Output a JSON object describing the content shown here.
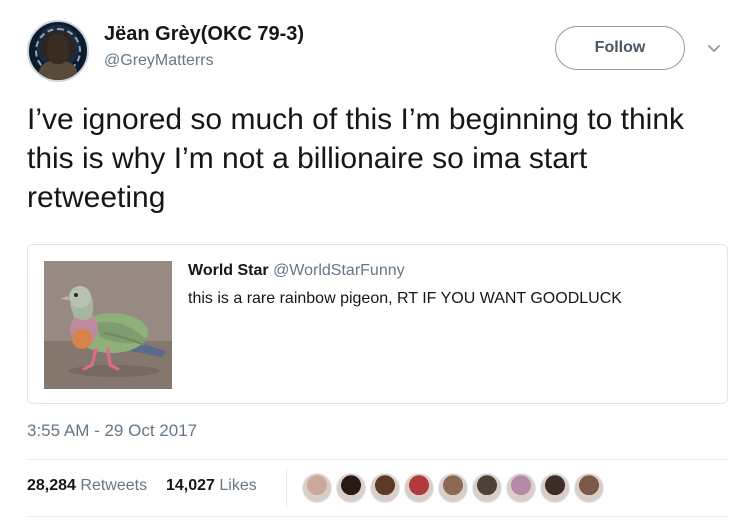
{
  "author": {
    "name": "Jëan Grèy(OKC 79-3)",
    "handle": "@GreyMatterrs",
    "avatar_icon": "avatar-image"
  },
  "actions": {
    "follow_label": "Follow",
    "menu_icon": "chevron-down-icon"
  },
  "tweet": {
    "text": "I’ve ignored so much of this I’m beginning to think this is why I’m not a billionaire so ima start retweeting",
    "timestamp": "3:55 AM - 29 Oct 2017"
  },
  "quoted_tweet": {
    "name": "World Star",
    "handle": "@WorldStarFunny",
    "text": "this is a rare rainbow pigeon, RT IF YOU WANT GOODLUCK",
    "image_icon": "rainbow-pigeon-photo"
  },
  "stats": {
    "retweets_count": "28,284",
    "retweets_label": "Retweets",
    "likes_count": "14,027",
    "likes_label": "Likes"
  },
  "liker_avatars": [
    {
      "color": "#c9a99a"
    },
    {
      "color": "#2a1a14"
    },
    {
      "color": "#5b3a2a"
    },
    {
      "color": "#b13a3a"
    },
    {
      "color": "#8a6a55"
    },
    {
      "color": "#4c4238"
    },
    {
      "color": "#b58aa8"
    },
    {
      "color": "#3d2e2a"
    },
    {
      "color": "#7a5a48"
    }
  ],
  "colors": {
    "text": "#14171a",
    "secondary": "#657786",
    "border": "#e1e8ed"
  }
}
